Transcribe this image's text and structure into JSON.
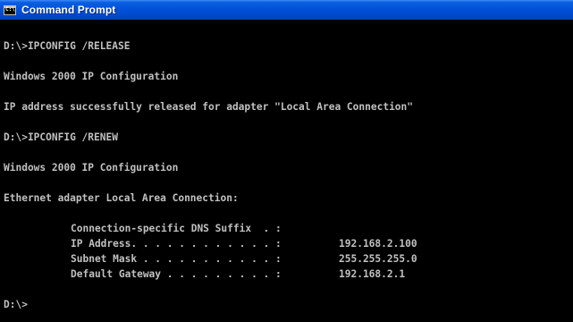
{
  "window": {
    "title": "Command Prompt",
    "icon": "console-icon"
  },
  "console": {
    "cmd1": "D:\\>IPCONFIG /RELEASE",
    "header1": "Windows 2000 IP Configuration",
    "release_msg": "IP address successfully released for adapter \"Local Area Connection\"",
    "cmd2": "D:\\>IPCONFIG /RENEW",
    "header2": "Windows 2000 IP Configuration",
    "adapter": "Ethernet adapter Local Area Connection:",
    "rows": [
      {
        "label": "Connection-specific DNS Suffix  . :",
        "value": ""
      },
      {
        "label": "IP Address. . . . . . . . . . . . :",
        "value": "192.168.2.100"
      },
      {
        "label": "Subnet Mask . . . . . . . . . . . :",
        "value": "255.255.255.0"
      },
      {
        "label": "Default Gateway . . . . . . . . . :",
        "value": "192.168.2.1"
      }
    ],
    "prompt": "D:\\>"
  }
}
